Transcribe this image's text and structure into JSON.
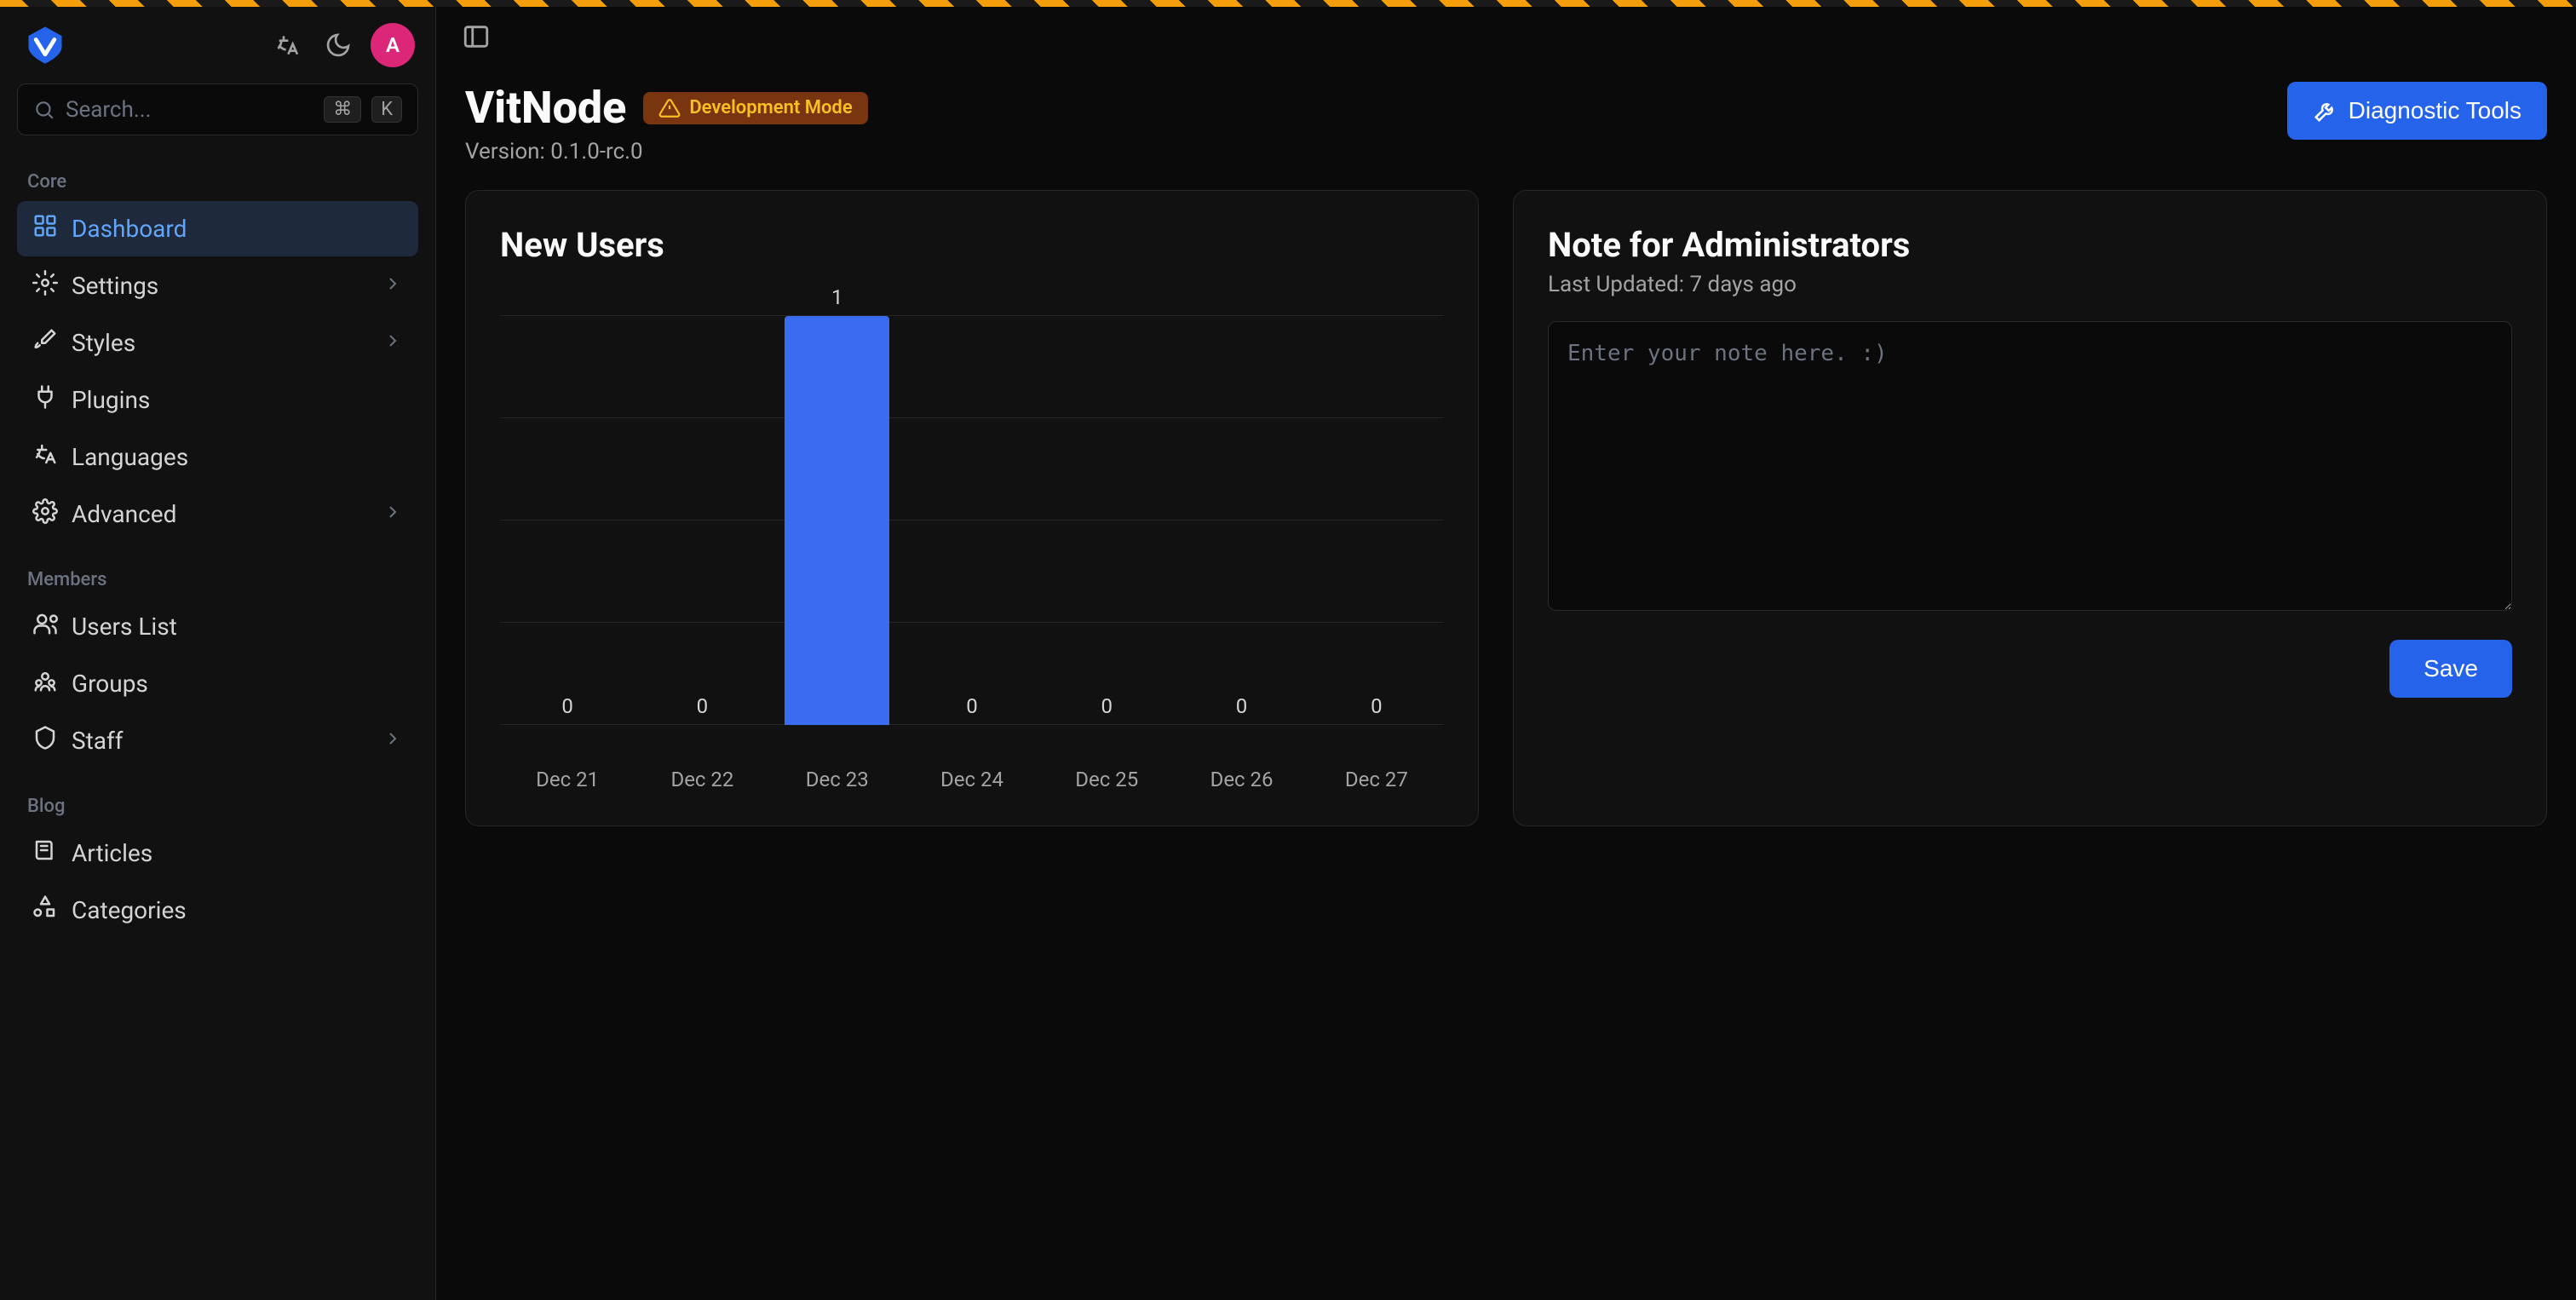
{
  "app": {
    "title": "VitNode",
    "dev_badge": "Development Mode",
    "version": "Version: 0.1.0-rc.0"
  },
  "search": {
    "placeholder": "Search...",
    "kbd1": "⌘",
    "kbd2": "K"
  },
  "avatar_initial": "A",
  "sidebar": {
    "sections": [
      {
        "heading": "Core",
        "items": [
          {
            "label": "Dashboard",
            "icon": "layout-grid",
            "active": true
          },
          {
            "label": "Settings",
            "icon": "gear",
            "chevron": true
          },
          {
            "label": "Styles",
            "icon": "paintbrush",
            "chevron": true
          },
          {
            "label": "Plugins",
            "icon": "plug"
          },
          {
            "label": "Languages",
            "icon": "languages"
          },
          {
            "label": "Advanced",
            "icon": "cog",
            "chevron": true
          }
        ]
      },
      {
        "heading": "Members",
        "items": [
          {
            "label": "Users List",
            "icon": "users"
          },
          {
            "label": "Groups",
            "icon": "group"
          },
          {
            "label": "Staff",
            "icon": "shield",
            "chevron": true
          }
        ]
      },
      {
        "heading": "Blog",
        "items": [
          {
            "label": "Articles",
            "icon": "book"
          },
          {
            "label": "Categories",
            "icon": "shapes"
          }
        ]
      }
    ]
  },
  "header": {
    "diag_button": "Diagnostic Tools"
  },
  "chart_data": {
    "type": "bar",
    "title": "New Users",
    "categories": [
      "Dec 21",
      "Dec 22",
      "Dec 23",
      "Dec 24",
      "Dec 25",
      "Dec 26",
      "Dec 27"
    ],
    "values": [
      0,
      0,
      1,
      0,
      0,
      0,
      0
    ],
    "ylim": [
      0,
      1
    ]
  },
  "note": {
    "title": "Note for Administrators",
    "subtitle": "Last Updated: 7 days ago",
    "placeholder": "Enter your note here. :)",
    "value": "",
    "save_label": "Save"
  }
}
